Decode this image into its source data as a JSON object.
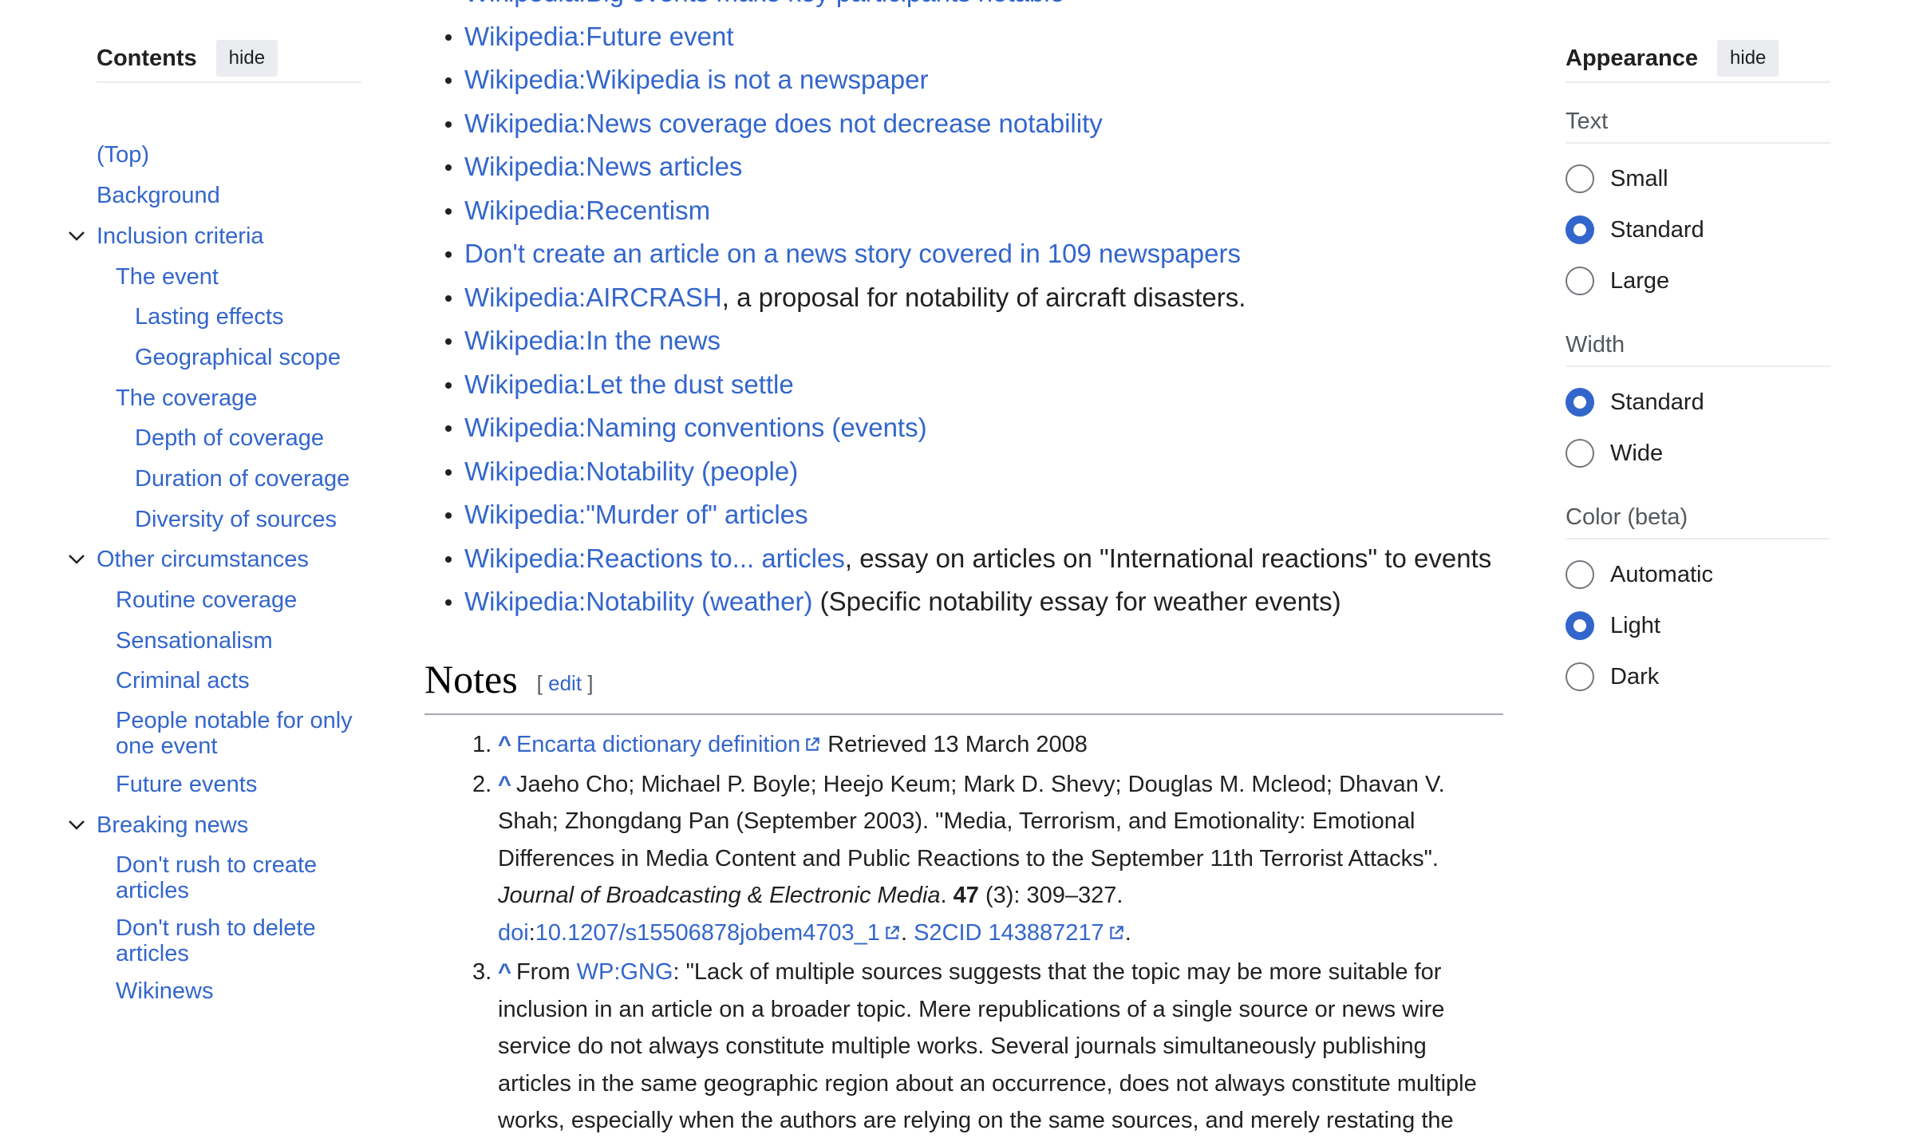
{
  "toc": {
    "title": "Contents",
    "hide_label": "hide",
    "items": [
      {
        "label": "(Top)",
        "level": 1,
        "collapsible": false
      },
      {
        "label": "Background",
        "level": 1,
        "collapsible": false
      },
      {
        "label": "Inclusion criteria",
        "level": 1,
        "collapsible": true
      },
      {
        "label": "The event",
        "level": 2,
        "collapsible": false
      },
      {
        "label": "Lasting effects",
        "level": 3,
        "collapsible": false
      },
      {
        "label": "Geographical scope",
        "level": 3,
        "collapsible": false
      },
      {
        "label": "The coverage",
        "level": 2,
        "collapsible": false
      },
      {
        "label": "Depth of coverage",
        "level": 3,
        "collapsible": false
      },
      {
        "label": "Duration of coverage",
        "level": 3,
        "collapsible": false
      },
      {
        "label": "Diversity of sources",
        "level": 3,
        "collapsible": false
      },
      {
        "label": "Other circumstances",
        "level": 1,
        "collapsible": true
      },
      {
        "label": "Routine coverage",
        "level": 2,
        "collapsible": false
      },
      {
        "label": "Sensationalism",
        "level": 2,
        "collapsible": false
      },
      {
        "label": "Criminal acts",
        "level": 2,
        "collapsible": false
      },
      {
        "label": "People notable for only one event",
        "level": 2,
        "collapsible": false
      },
      {
        "label": "Future events",
        "level": 2,
        "collapsible": false
      },
      {
        "label": "Breaking news",
        "level": 1,
        "collapsible": true
      },
      {
        "label": "Don't rush to create articles",
        "level": 2,
        "collapsible": false
      },
      {
        "label": "Don't rush to delete articles",
        "level": 2,
        "collapsible": false
      },
      {
        "label": "Wikinews",
        "level": 2,
        "collapsible": false
      }
    ]
  },
  "see_also": [
    {
      "link": "Wikipedia:Big events make key participants notable",
      "text": ""
    },
    {
      "link": "Wikipedia:Future event",
      "text": ""
    },
    {
      "link": "Wikipedia:Wikipedia is not a newspaper",
      "text": ""
    },
    {
      "link": "Wikipedia:News coverage does not decrease notability",
      "text": ""
    },
    {
      "link": "Wikipedia:News articles",
      "text": ""
    },
    {
      "link": "Wikipedia:Recentism",
      "text": ""
    },
    {
      "link": "Don't create an article on a news story covered in 109 newspapers",
      "text": ""
    },
    {
      "link": "Wikipedia:AIRCRASH",
      "text": ", a proposal for notability of aircraft disasters."
    },
    {
      "link": "Wikipedia:In the news",
      "text": ""
    },
    {
      "link": "Wikipedia:Let the dust settle",
      "text": ""
    },
    {
      "link": "Wikipedia:Naming conventions (events)",
      "text": ""
    },
    {
      "link": "Wikipedia:Notability (people)",
      "text": ""
    },
    {
      "link": "Wikipedia:\"Murder of\" articles",
      "text": ""
    },
    {
      "link": "Wikipedia:Reactions to... articles",
      "text": ", essay on articles on \"International reactions\" to events"
    },
    {
      "link": "Wikipedia:Notability (weather)",
      "text": " (Specific notability essay for weather events)"
    }
  ],
  "notes": {
    "heading": "Notes",
    "edit_open": "[",
    "edit_label": "edit",
    "edit_close": "]",
    "refs": [
      {
        "num": "1.",
        "caret": "^",
        "link": "Encarta dictionary definition",
        "text": " Retrieved 13 March 2008"
      },
      {
        "num": "2.",
        "caret": "^",
        "text_a": "Jaeho Cho; Michael P. Boyle; Heejo Keum; Mark D. Shevy; Douglas M. Mcleod; Dhavan V. Shah; Zhongdang Pan (September 2003). \"Media, Terrorism, and Emotionality: Emotional Differences in Media Content and Public Reactions to the September 11th Terrorist Attacks\". ",
        "journal": "Journal of Broadcasting & Electronic Media",
        "text_b": ". ",
        "volume": "47",
        "text_c": " (3): 309–327.",
        "doi_label": "doi",
        "doi_sep": ":",
        "doi_link": "10.1207/s15506878jobem4703_1",
        "sep": ". ",
        "s2cid_link": "S2CID 143887217",
        "end": "."
      },
      {
        "num": "3.",
        "caret": "^",
        "text_a": "From ",
        "link": "WP:GNG",
        "text_b": ": \"Lack of multiple sources suggests that the topic may be more suitable for inclusion in an article on a broader topic. Mere republications of a single source or news wire service do not always constitute multiple works. Several journals simultaneously publishing articles in the same geographic region about an occurrence, does not always constitute multiple works, especially when the authors are relying on the same sources, and merely restating the"
      }
    ]
  },
  "appearance": {
    "title": "Appearance",
    "hide_label": "hide",
    "groups": [
      {
        "label": "Text",
        "options": [
          {
            "label": "Small",
            "checked": false
          },
          {
            "label": "Standard",
            "checked": true
          },
          {
            "label": "Large",
            "checked": false
          }
        ]
      },
      {
        "label": "Width",
        "options": [
          {
            "label": "Standard",
            "checked": true
          },
          {
            "label": "Wide",
            "checked": false
          }
        ]
      },
      {
        "label": "Color (beta)",
        "options": [
          {
            "label": "Automatic",
            "checked": false
          },
          {
            "label": "Light",
            "checked": true
          },
          {
            "label": "Dark",
            "checked": false
          }
        ]
      }
    ]
  },
  "colors": {
    "link": "#3366cc",
    "text": "#202122",
    "accent": "#3366cc"
  }
}
